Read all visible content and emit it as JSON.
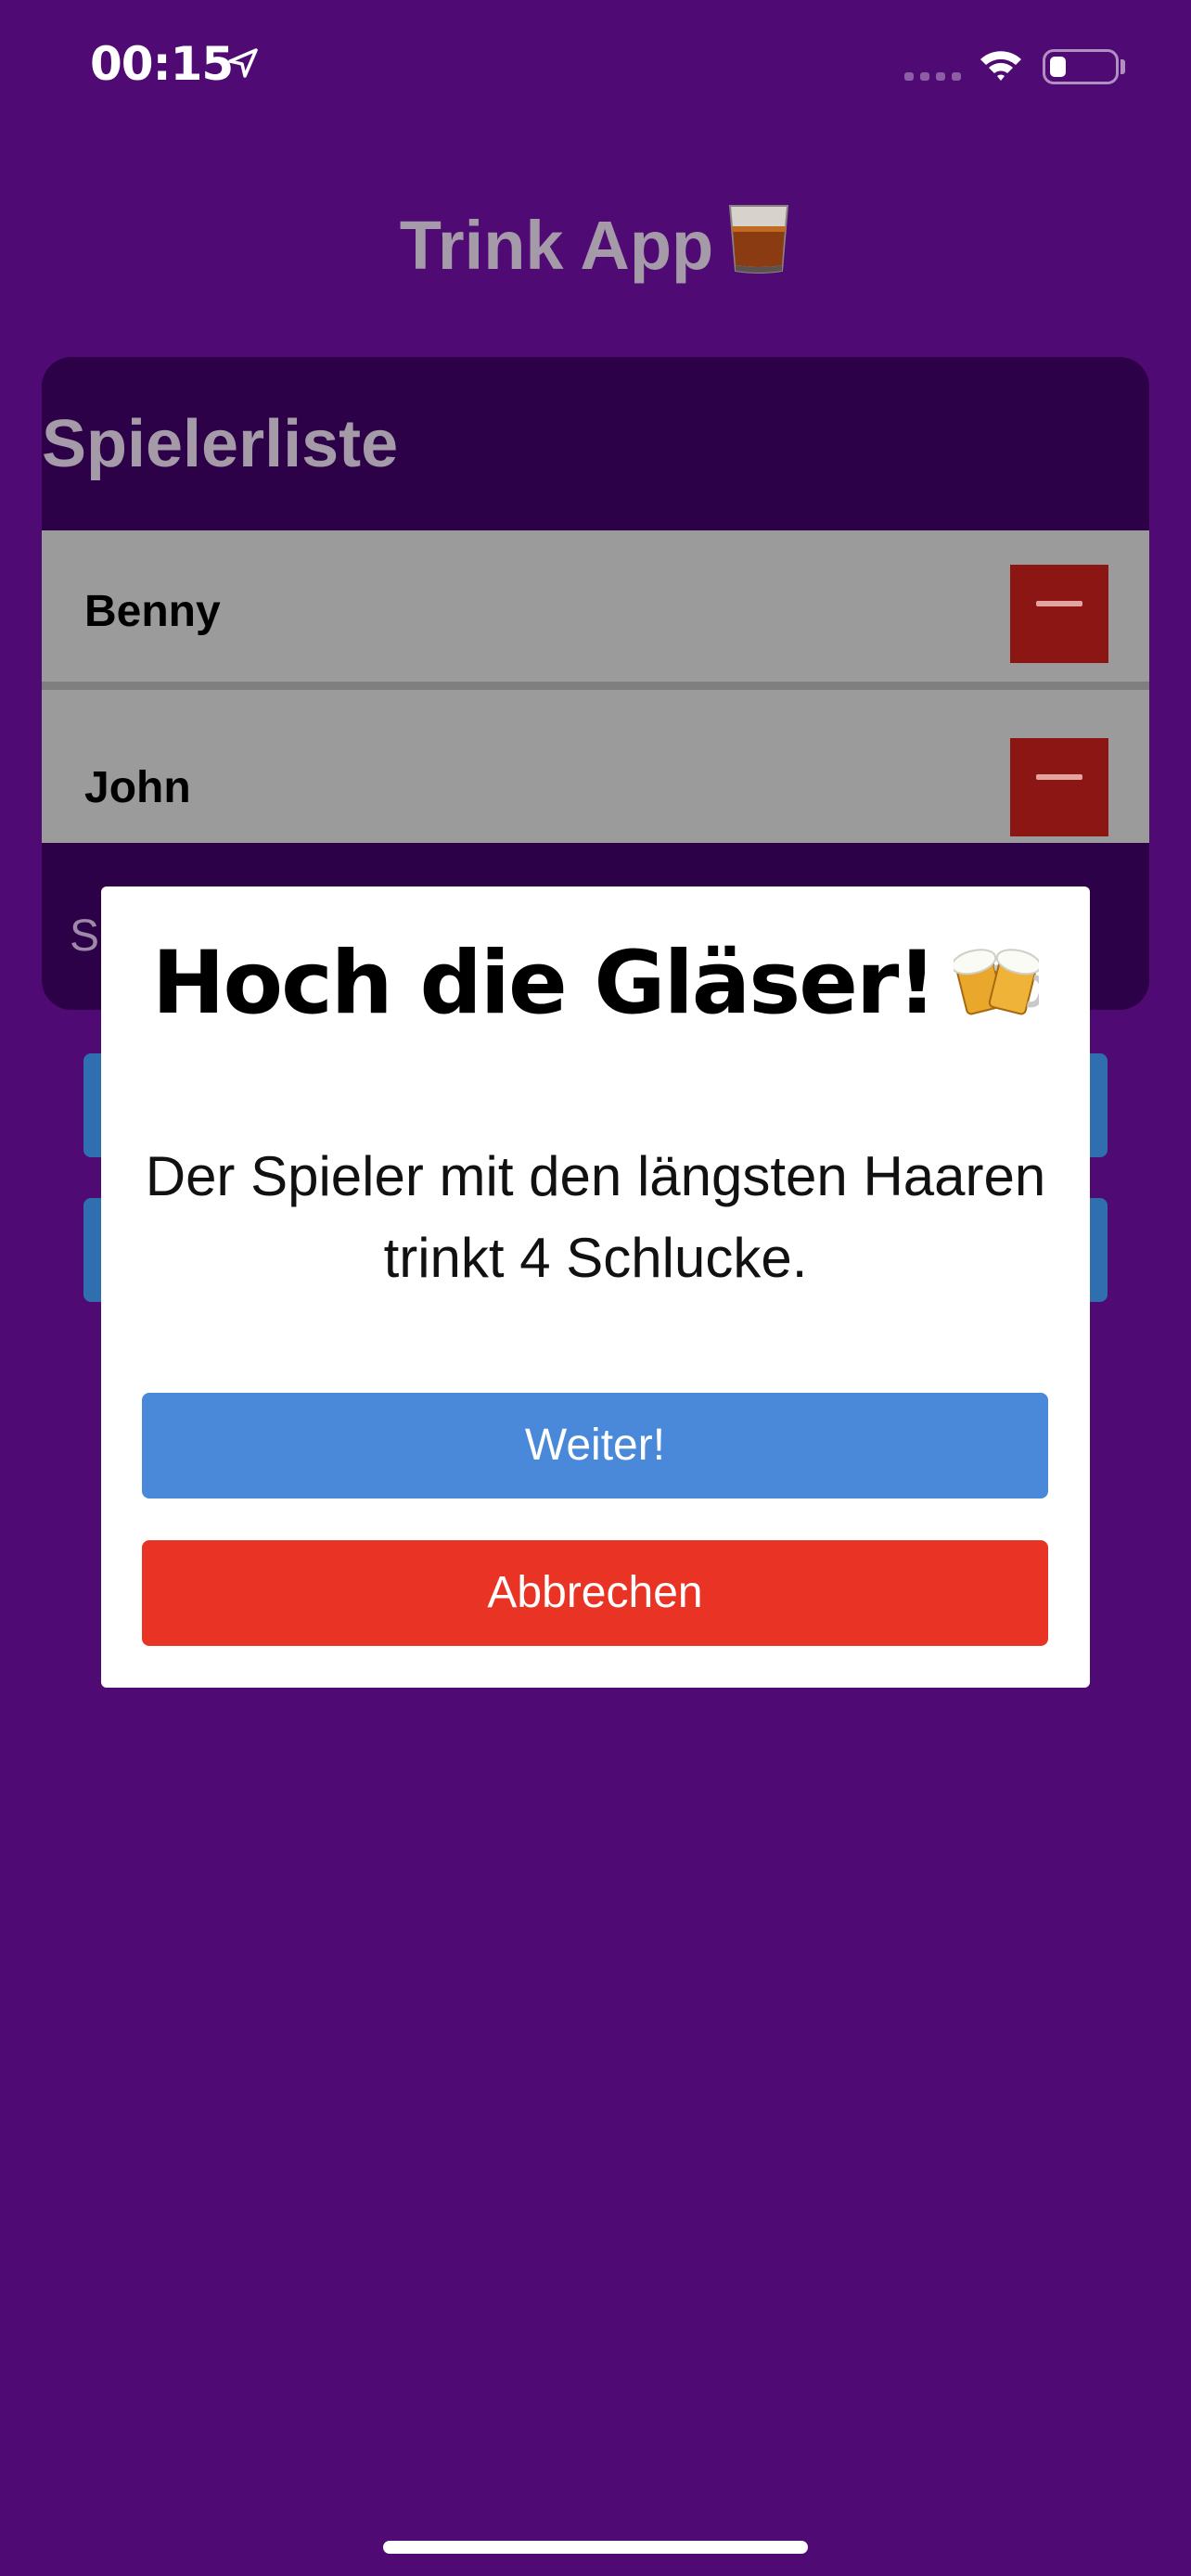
{
  "status_bar": {
    "time": "00:15",
    "battery_level": 0.25,
    "icons": [
      "location-arrow-icon",
      "signal-icon",
      "wifi-icon",
      "battery-icon"
    ]
  },
  "header": {
    "title": "Trink App",
    "title_icon": "tumbler-glass-icon"
  },
  "player_list": {
    "title": "Spielerliste",
    "players": [
      {
        "name": "Benny"
      },
      {
        "name": "John"
      }
    ],
    "remove_icon": "minus-icon",
    "footer_partial_text": "Sp"
  },
  "modal": {
    "title": "Hoch die Gläser!",
    "title_icon": "beer-mugs-icon",
    "message": "Der Spieler mit den längsten Haaren trinkt 4 Schlucke.",
    "next_label": "Weiter!",
    "cancel_label": "Abbrechen"
  },
  "colors": {
    "background": "#4f0a74",
    "card": "#2c0148",
    "row": "#9b9b9b",
    "remove_button": "#8c1614",
    "primary_button": "#4a89da",
    "danger_button": "#e93324"
  }
}
